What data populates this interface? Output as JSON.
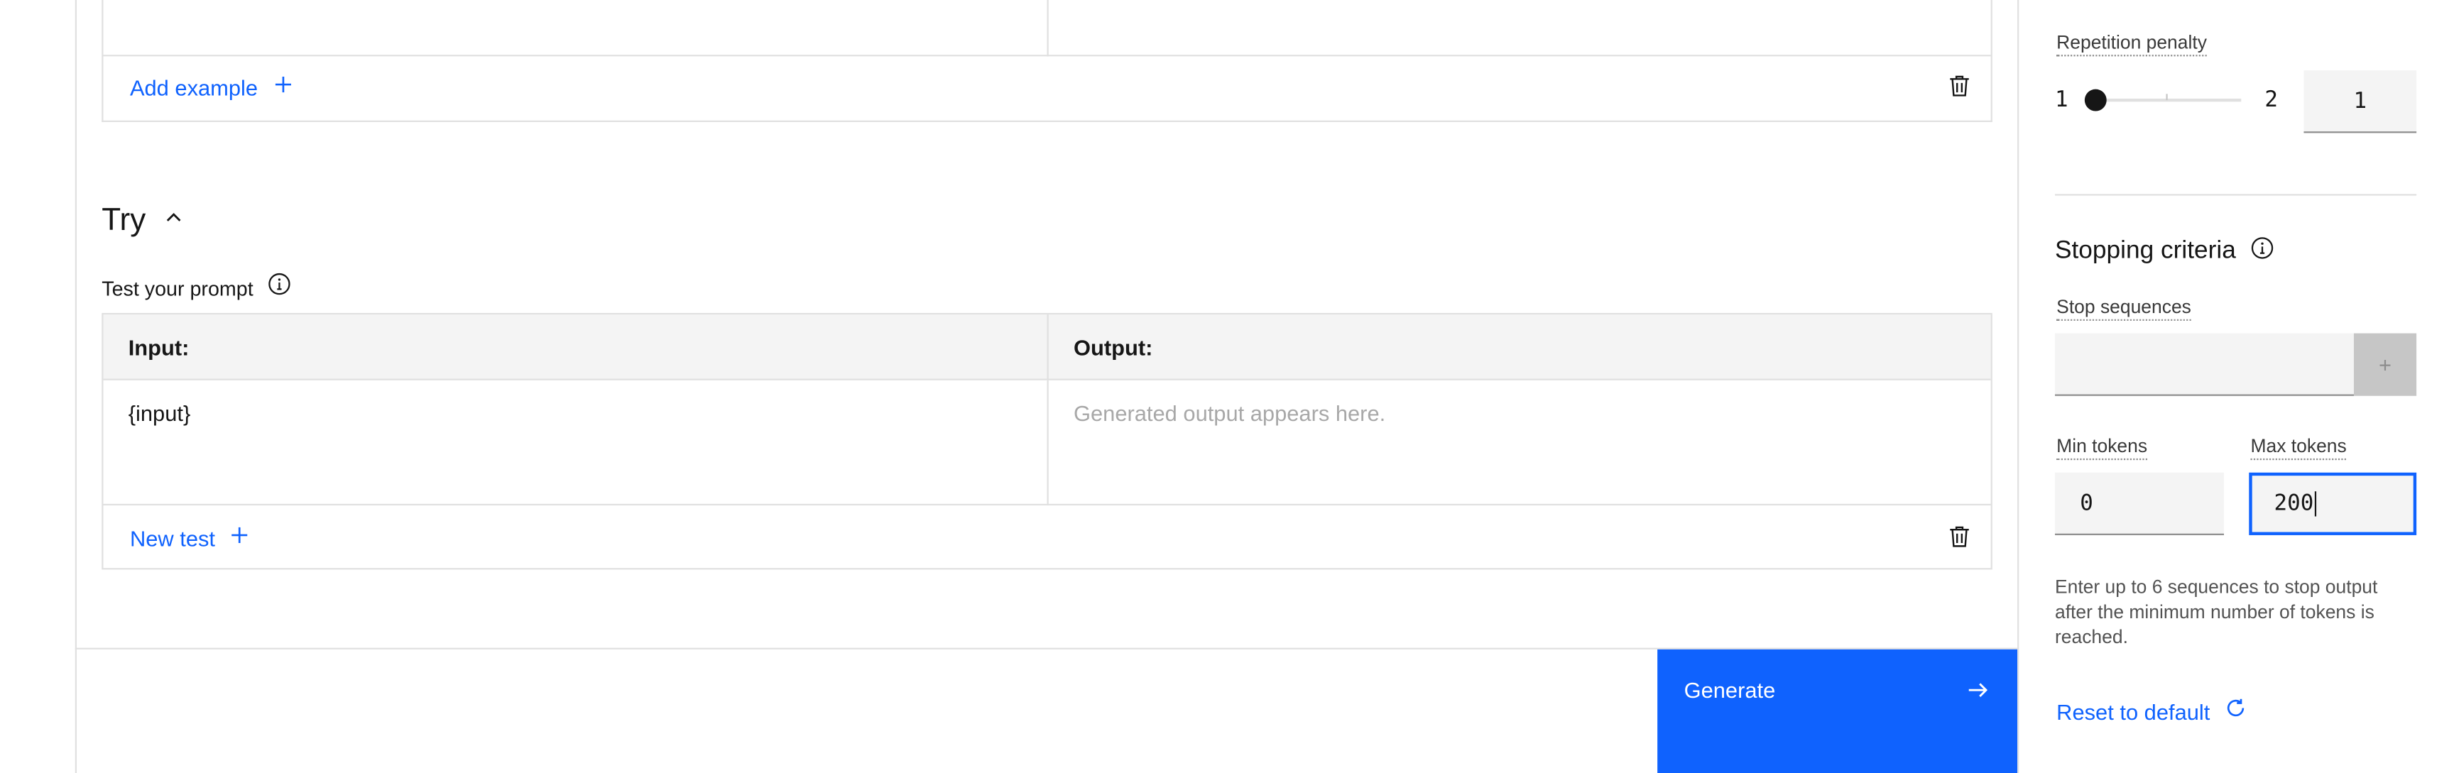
{
  "examples": {
    "add_example_label": "Add example",
    "add_icon": "plus-icon",
    "delete_icon": "trash-icon"
  },
  "try_section": {
    "title": "Try",
    "collapse_icon": "chevron-up-icon",
    "test_prompt_label": "Test your prompt",
    "info_icon": "info-icon",
    "table": {
      "headers": [
        "Input:",
        "Output:"
      ],
      "rows": [
        {
          "input": "{input}",
          "output_placeholder": "Generated output appears here."
        }
      ]
    },
    "new_test_label": "New test",
    "add_icon": "plus-icon",
    "delete_icon": "trash-icon"
  },
  "footer": {
    "generate_label": "Generate",
    "generate_icon": "arrow-right-icon"
  },
  "right_panel": {
    "repetition_penalty": {
      "label": "Repetition penalty",
      "min_label": "1",
      "max_label": "2",
      "value": "1"
    },
    "stopping_criteria": {
      "title": "Stopping criteria",
      "info_icon": "info-icon",
      "stop_sequences_label": "Stop sequences",
      "stop_sequences_value": "",
      "add_button_symbol": "+",
      "min_tokens_label": "Min tokens",
      "min_tokens_value": "0",
      "max_tokens_label": "Max tokens",
      "max_tokens_value": "200",
      "helper_text": "Enter up to 6 sequences to stop output after the minimum number of tokens is reached."
    },
    "reset_label": "Reset to default",
    "reset_icon": "reset-icon"
  },
  "colors": {
    "accent": "#0f62fe",
    "border": "#e0e0e0",
    "header_bg": "#f4f4f4",
    "field_bg": "#f4f4f4"
  }
}
